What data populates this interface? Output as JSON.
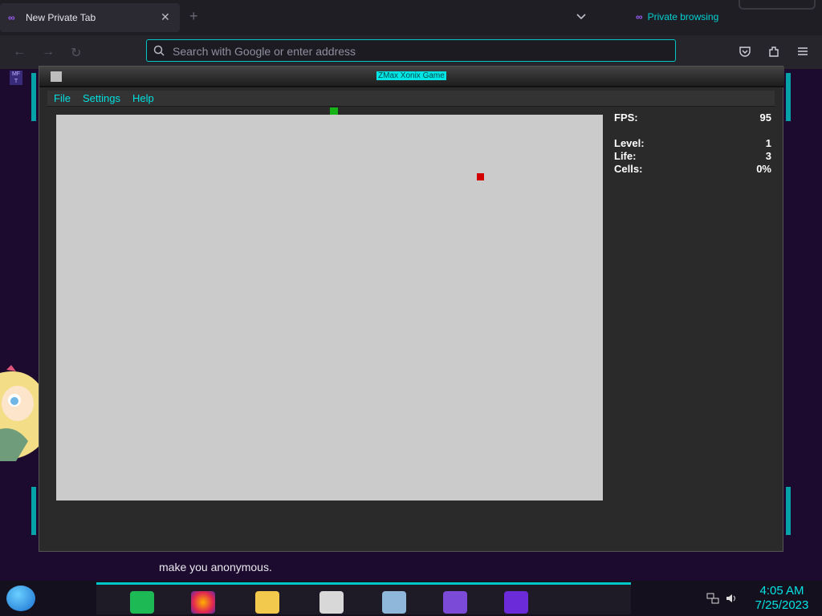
{
  "browser": {
    "tab_title": "New Private Tab",
    "private_label": "Private browsing",
    "url_placeholder": "Search with Google or enter address",
    "bookmark_label": "MF T"
  },
  "game_window": {
    "title": "ZMax Xonix Game",
    "menu": [
      "File",
      "Settings",
      "Help"
    ],
    "stats": {
      "fps_label": "FPS:",
      "fps_value": "95",
      "level_label": "Level:",
      "level_value": "1",
      "life_label": "Life:",
      "life_value": "3",
      "cells_label": "Cells:",
      "cells_value": "0%"
    }
  },
  "background_text": "make you anonymous.",
  "taskbar": {
    "time": "4:05 AM",
    "date": "7/25/2023"
  },
  "colors": {
    "accent": "#00e5e5",
    "player": "#16b416",
    "enemy": "#d20000",
    "playfield": "#cbcbcb"
  }
}
